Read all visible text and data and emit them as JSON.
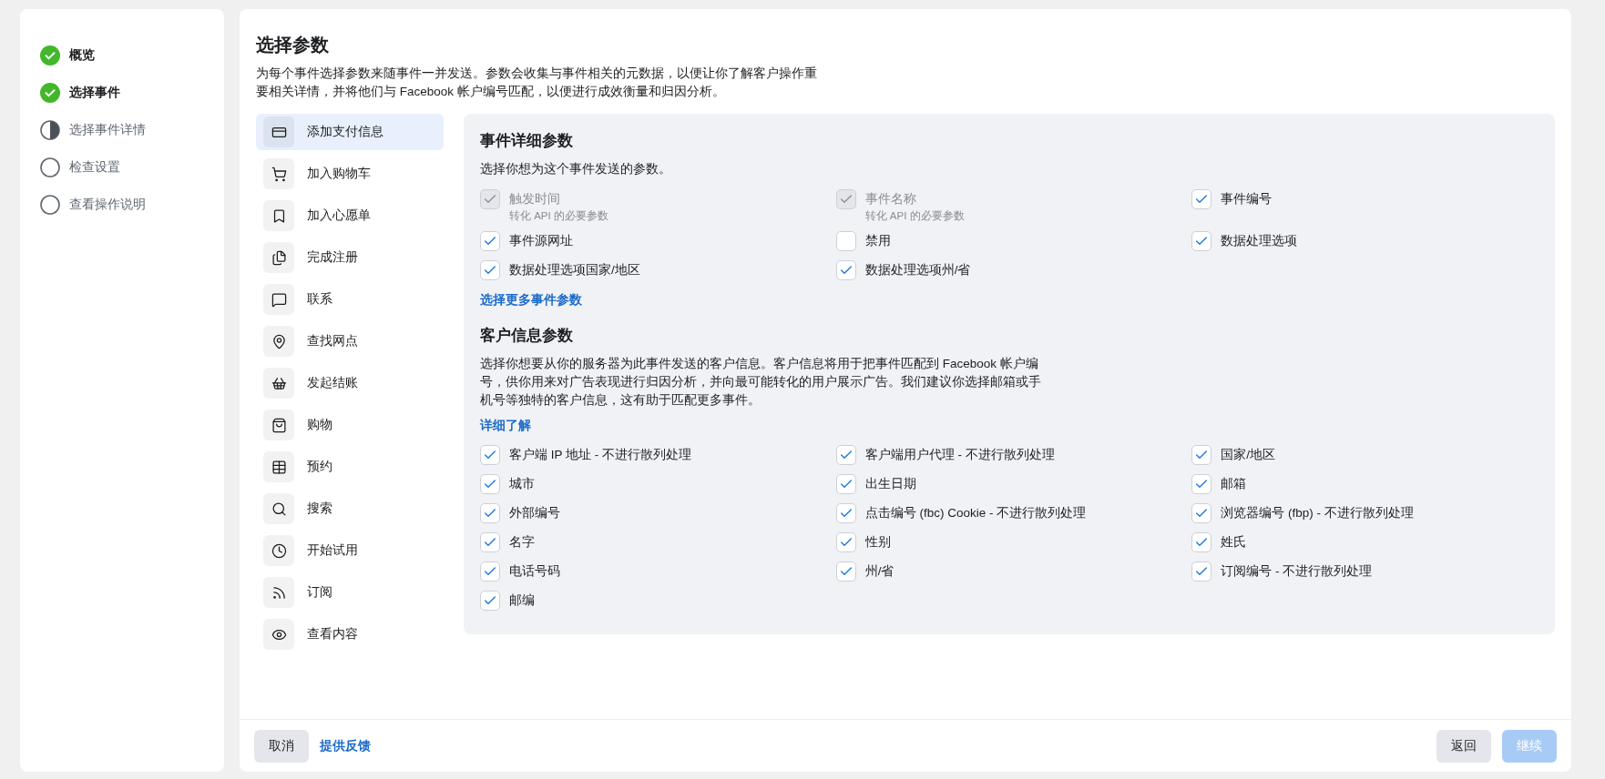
{
  "steps": [
    {
      "label": "概览",
      "kind": "done"
    },
    {
      "label": "选择事件",
      "kind": "done"
    },
    {
      "label": "选择事件详情",
      "kind": "current"
    },
    {
      "label": "检查设置",
      "kind": "todo"
    },
    {
      "label": "查看操作说明",
      "kind": "todo"
    }
  ],
  "header": {
    "title": "选择参数",
    "description": "为每个事件选择参数来随事件一并发送。参数会收集与事件相关的元数据，以便让你了解客户操作重要相关详情，并将他们与 Facebook 帐户编号匹配，以便进行成效衡量和归因分析。"
  },
  "events": [
    {
      "label": "添加支付信息",
      "selected": true
    },
    {
      "label": "加入购物车",
      "selected": false
    },
    {
      "label": "加入心愿单",
      "selected": false
    },
    {
      "label": "完成注册",
      "selected": false
    },
    {
      "label": "联系",
      "selected": false
    },
    {
      "label": "查找网点",
      "selected": false
    },
    {
      "label": "发起结账",
      "selected": false
    },
    {
      "label": "购物",
      "selected": false
    },
    {
      "label": "预约",
      "selected": false
    },
    {
      "label": "搜索",
      "selected": false
    },
    {
      "label": "开始试用",
      "selected": false
    },
    {
      "label": "订阅",
      "selected": false
    },
    {
      "label": "查看内容",
      "selected": false
    }
  ],
  "event_params": {
    "title": "事件详细参数",
    "description": "选择你想为这个事件发送的参数。",
    "items": [
      {
        "label": "触发时间",
        "note": "转化 API 的必要参数",
        "checked": true,
        "disabled": true
      },
      {
        "label": "事件名称",
        "note": "转化 API 的必要参数",
        "checked": true,
        "disabled": true
      },
      {
        "label": "事件编号",
        "checked": true,
        "disabled": false
      },
      {
        "label": "事件源网址",
        "checked": true,
        "disabled": false
      },
      {
        "label": "禁用",
        "checked": false,
        "disabled": false
      },
      {
        "label": "数据处理选项",
        "checked": true,
        "disabled": false
      },
      {
        "label": "数据处理选项国家/地区",
        "checked": true,
        "disabled": false
      },
      {
        "label": "数据处理选项州/省",
        "checked": true,
        "disabled": false
      }
    ],
    "more_link": "选择更多事件参数"
  },
  "customer_params": {
    "title": "客户信息参数",
    "description": "选择你想要从你的服务器为此事件发送的客户信息。客户信息将用于把事件匹配到 Facebook 帐户编号，供你用来对广告表现进行归因分析，并向最可能转化的用户展示广告。我们建议你选择邮箱或手机号等独特的客户信息，这有助于匹配更多事件。",
    "learn_more": "详细了解",
    "items": [
      {
        "label": "客户端 IP 地址 - 不进行散列处理",
        "checked": true
      },
      {
        "label": "客户端用户代理 - 不进行散列处理",
        "checked": true
      },
      {
        "label": "国家/地区",
        "checked": true
      },
      {
        "label": "城市",
        "checked": true
      },
      {
        "label": "出生日期",
        "checked": true
      },
      {
        "label": "邮箱",
        "checked": true
      },
      {
        "label": "外部编号",
        "checked": true
      },
      {
        "label": "点击编号 (fbc) Cookie - 不进行散列处理",
        "checked": true
      },
      {
        "label": "浏览器编号 (fbp) - 不进行散列处理",
        "checked": true
      },
      {
        "label": "名字",
        "checked": true
      },
      {
        "label": "性别",
        "checked": true
      },
      {
        "label": "姓氏",
        "checked": true
      },
      {
        "label": "电话号码",
        "checked": true
      },
      {
        "label": "州/省",
        "checked": true
      },
      {
        "label": "订阅编号 - 不进行散列处理",
        "checked": true
      },
      {
        "label": "邮编",
        "checked": true
      }
    ]
  },
  "footer": {
    "cancel": "取消",
    "feedback": "提供反馈",
    "back": "返回",
    "continue": {
      "label": "继续",
      "disabled": true
    }
  }
}
